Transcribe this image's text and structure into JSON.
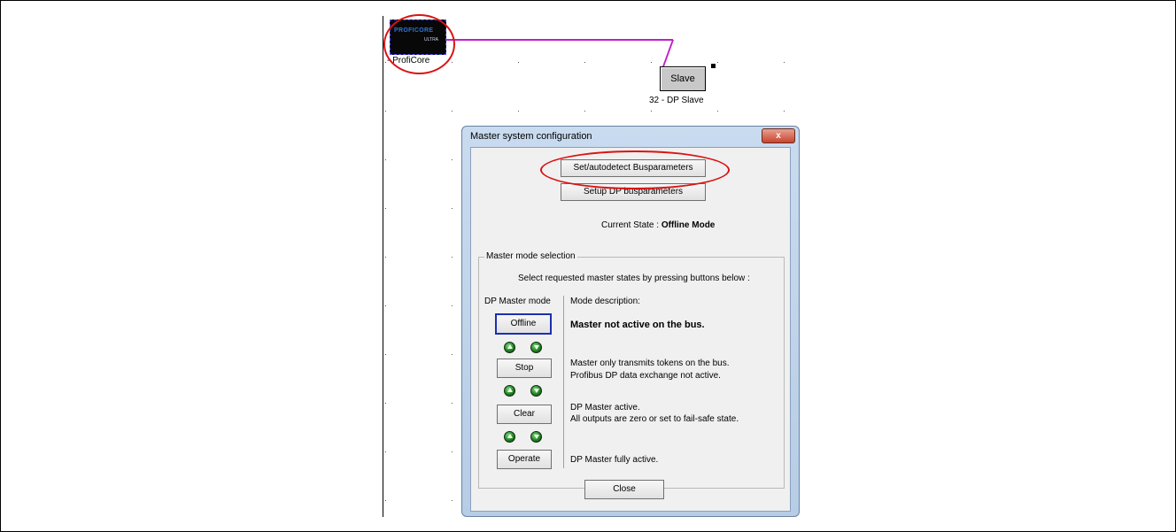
{
  "network": {
    "master_device_label": "- ProfiCore",
    "device_logo_text": "PROFICORE",
    "device_logo_subtext": "ULTRA",
    "slave_button_label": "Slave",
    "slave_device_label": "32 - DP Slave"
  },
  "dialog": {
    "title": "Master system configuration",
    "close_x": "x",
    "set_autodetect_label": "Set/autodetect Busparameters",
    "setup_dp_label": "Setup DP busparameters",
    "current_state_label": "Current State : ",
    "current_state_value": "Offline Mode",
    "group_label": "Master mode selection",
    "instructions": "Select requested master states by pressing buttons below :",
    "dp_master_mode_header": "DP Master mode",
    "mode_description_header": "Mode description:",
    "modes": [
      {
        "button": "Offline",
        "desc1": "Master not active on the bus.",
        "desc2": ""
      },
      {
        "button": "Stop",
        "desc1": "Master only transmits tokens on the bus.",
        "desc2": "Profibus DP data exchange not active."
      },
      {
        "button": "Clear",
        "desc1": "DP Master active.",
        "desc2": "All outputs are zero or set to fail-safe state."
      },
      {
        "button": "Operate",
        "desc1": "DP Master fully active.",
        "desc2": ""
      }
    ],
    "close_button_label": "Close"
  },
  "colors": {
    "bus_line": "#c21ecb",
    "highlight_ellipse": "#d81414",
    "selected_button_border": "#1a2fb5",
    "led_green": "#1f7a1f"
  }
}
